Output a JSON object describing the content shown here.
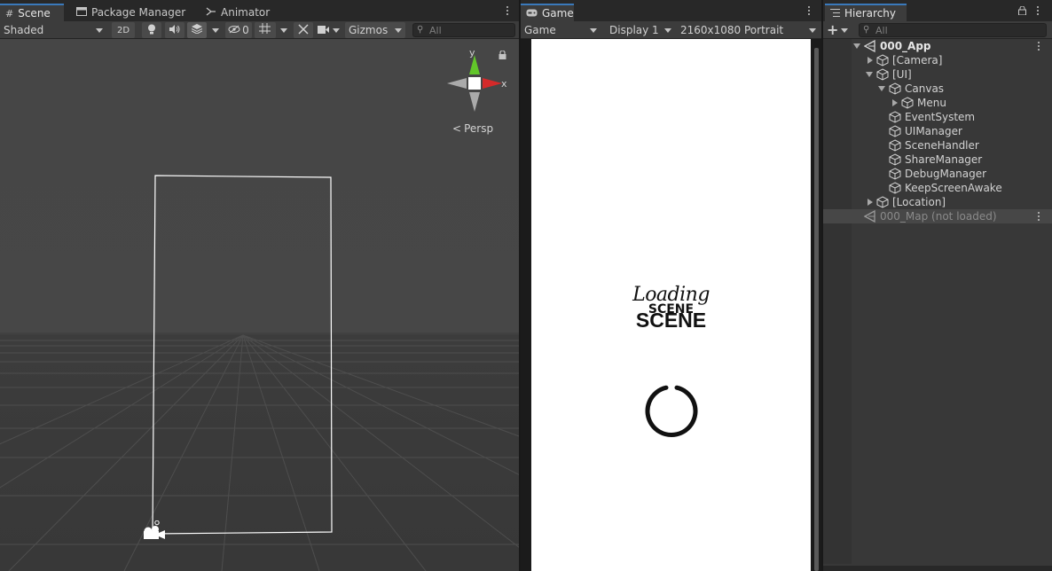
{
  "scene_panel": {
    "tabs": [
      {
        "label": "Scene",
        "icon": "grid-hash-icon"
      },
      {
        "label": "Package Manager",
        "icon": "package-icon"
      },
      {
        "label": "Animator",
        "icon": "animator-icon"
      }
    ],
    "toolbar": {
      "shading_mode": "Shaded",
      "mode_2d": "2D",
      "hidden_count": "0",
      "gizmos": "Gizmos",
      "search_placeholder": "All"
    },
    "gizmo": {
      "y_label": "y",
      "x_label": "x",
      "projection": "Persp"
    }
  },
  "game_panel": {
    "tab": {
      "label": "Game",
      "icon": "gamepad-icon"
    },
    "toolbar": {
      "view_mode": "Game",
      "display": "Display 1",
      "resolution": "2160x1080 Portrait"
    },
    "screen": {
      "loading_text": "Loading",
      "scene_overlay": "SCENE",
      "scene_text": "SCENE"
    }
  },
  "hierarchy_panel": {
    "tab": {
      "label": "Hierarchy",
      "icon": "list-icon"
    },
    "search_placeholder": "All",
    "items": [
      {
        "label": "000_App",
        "depth": 0,
        "expanded": true,
        "kind": "scene"
      },
      {
        "label": "[Camera]",
        "depth": 1,
        "expanded": false,
        "kind": "object"
      },
      {
        "label": "[UI]",
        "depth": 1,
        "expanded": true,
        "kind": "object"
      },
      {
        "label": "Canvas",
        "depth": 2,
        "expanded": true,
        "kind": "object"
      },
      {
        "label": "Menu",
        "depth": 3,
        "expanded": false,
        "kind": "object"
      },
      {
        "label": "EventSystem",
        "depth": 2,
        "kind": "object"
      },
      {
        "label": "UIManager",
        "depth": 2,
        "kind": "object"
      },
      {
        "label": "SceneHandler",
        "depth": 2,
        "kind": "object"
      },
      {
        "label": "ShareManager",
        "depth": 2,
        "kind": "object"
      },
      {
        "label": "DebugManager",
        "depth": 2,
        "kind": "object"
      },
      {
        "label": "KeepScreenAwake",
        "depth": 2,
        "kind": "object"
      },
      {
        "label": "[Location]",
        "depth": 1,
        "expanded": false,
        "kind": "object"
      },
      {
        "label": "000_Map (not loaded)",
        "depth": 0,
        "kind": "scene",
        "unloaded": true
      }
    ]
  },
  "colors": {
    "accent_tab": "#3a79bb",
    "gizmo_y": "#62c62a",
    "gizmo_x": "#d42a2a"
  }
}
